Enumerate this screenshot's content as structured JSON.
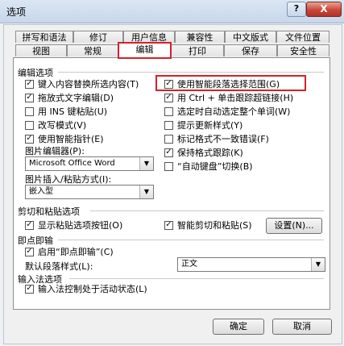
{
  "window": {
    "title": "选项",
    "help_label": "?",
    "close_label": "X"
  },
  "tabs_row1": [
    {
      "label": "拼写和语法"
    },
    {
      "label": "修订"
    },
    {
      "label": "用户信息"
    },
    {
      "label": "兼容性"
    },
    {
      "label": "中文版式"
    },
    {
      "label": "文件位置"
    }
  ],
  "tabs_row2": [
    {
      "label": "视图"
    },
    {
      "label": "常规"
    },
    {
      "label": "编辑",
      "active": true
    },
    {
      "label": "打印"
    },
    {
      "label": "保存"
    },
    {
      "label": "安全性"
    }
  ],
  "edit_options": {
    "title": "编辑选项",
    "left": [
      {
        "label": "键入内容替换所选内容(T)",
        "checked": true
      },
      {
        "label": "拖放式文字编辑(D)",
        "checked": true
      },
      {
        "label": "用 INS 键粘贴(U)",
        "checked": false
      },
      {
        "label": "改写模式(V)",
        "checked": false
      },
      {
        "label": "使用智能指针(E)",
        "checked": true
      }
    ],
    "right": [
      {
        "label": "使用智能段落选择范围(G)",
        "checked": true
      },
      {
        "label": "用 Ctrl + 单击跟踪超链接(H)",
        "checked": true
      },
      {
        "label": "选定时自动选定整个单词(W)",
        "checked": false
      },
      {
        "label": "提示更新样式(Y)",
        "checked": false
      },
      {
        "label": "标记格式不一致错误(F)",
        "checked": false
      },
      {
        "label": "保持格式跟踪(K)",
        "checked": true
      },
      {
        "label": "“自动键盘”切换(B)",
        "checked": false
      }
    ],
    "picture_editor_label": "图片编辑器(P):",
    "picture_editor_value": "Microsoft Office Word",
    "insert_paste_label": "图片插入/粘贴方式(I):",
    "insert_paste_value": "嵌入型"
  },
  "cut_paste": {
    "title": "剪切和粘贴选项",
    "show_paste_buttons": {
      "label": "显示粘贴选项按钮(O)",
      "checked": true
    },
    "smart_cut_paste": {
      "label": "智能剪切和粘贴(S)",
      "checked": true
    },
    "settings_label": "设置(N)..."
  },
  "click_type": {
    "title": "即点即输",
    "enable": {
      "label": "启用“即点即输”(C)",
      "checked": true
    },
    "default_style_label": "默认段落样式(L):",
    "default_style_value": "正文"
  },
  "ime": {
    "title": "输入法选项",
    "control": {
      "label": "输入法控制处于活动状态(L)",
      "checked": true
    }
  },
  "footer": {
    "ok_label": "确定",
    "cancel_label": "取消"
  },
  "colors": {
    "highlight": "#d6202a",
    "title_bar": "#c7d7ea"
  }
}
